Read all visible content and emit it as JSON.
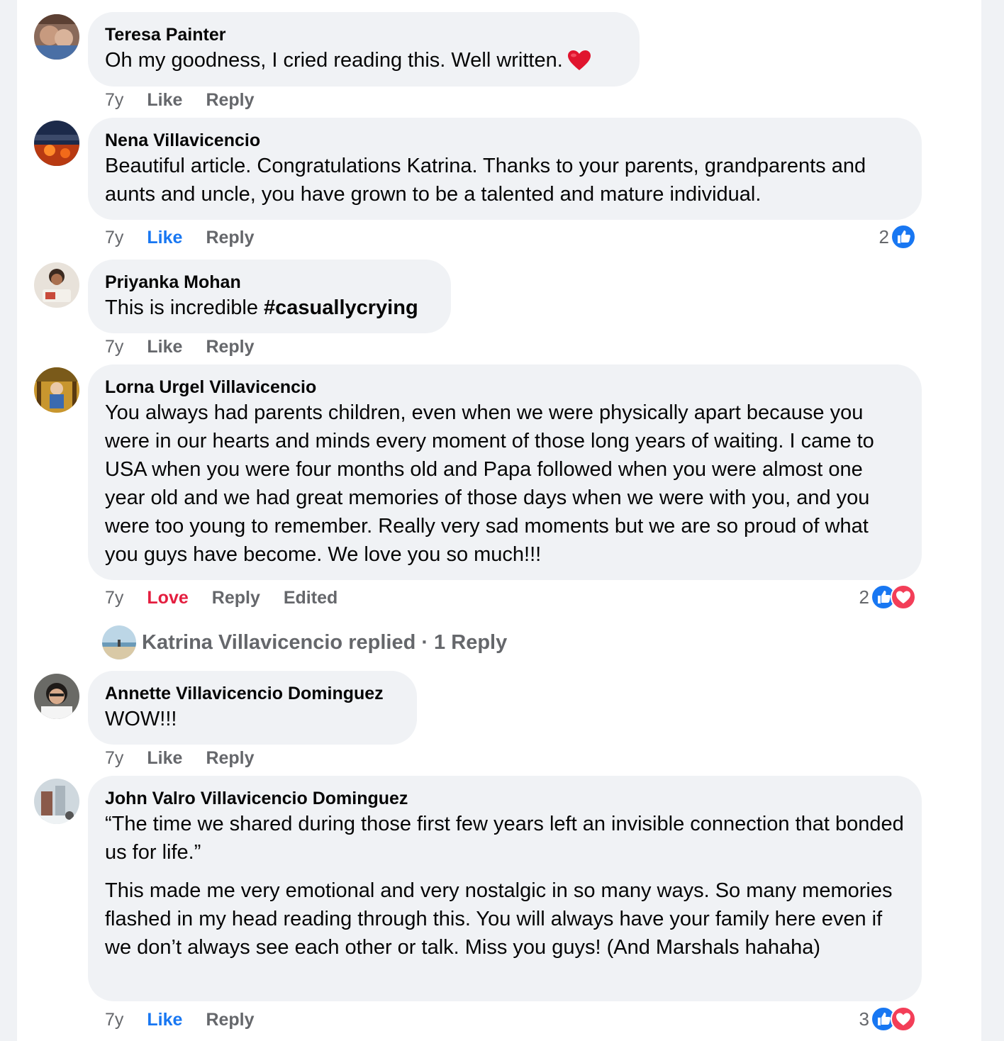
{
  "comments": [
    {
      "author": "Teresa Painter",
      "body": [
        "Oh my goodness, I cried reading this. Well written."
      ],
      "emoji": "red-heart",
      "time": "7y",
      "like_label": "Like",
      "reply_label": "Reply"
    },
    {
      "author": "Nena Villavicencio",
      "body": [
        "Beautiful article. Congratulations Katrina. Thanks to your parents, grandparents and aunts and uncle, you have grown to be a talented and mature individual."
      ],
      "time": "7y",
      "like_label": "Like",
      "like_state": "liked",
      "reply_label": "Reply",
      "reaction_count": "2",
      "reactions": [
        "like"
      ]
    },
    {
      "author": "Priyanka Mohan",
      "body_prefix": "This is incredible ",
      "hashtag": "#casuallycrying",
      "time": "7y",
      "like_label": "Like",
      "reply_label": "Reply"
    },
    {
      "author": "Lorna Urgel Villavicencio",
      "body": [
        "You always had parents children, even when we were physically apart because you were in our hearts and minds every moment of those long years of waiting. I came to USA when you were four months old and Papa followed when you were almost one year old and we had great memories of those days when we were with you, and you were too young to remember. Really very sad moments but we are so proud of what you guys have become. We love you so much!!!"
      ],
      "time": "7y",
      "like_label": "Love",
      "like_state": "loved",
      "reply_label": "Reply",
      "edited_label": "Edited",
      "reaction_count": "2",
      "reactions": [
        "like",
        "love"
      ],
      "replies_summary": "Katrina Villavicencio replied · 1 Reply"
    },
    {
      "author": "Annette Villavicencio Dominguez",
      "body": [
        "WOW!!!"
      ],
      "time": "7y",
      "like_label": "Like",
      "reply_label": "Reply"
    },
    {
      "author": "John Valro Villavicencio Dominguez",
      "body": [
        "“The time we shared during those first few years left an invisible connection that bonded us for life.”",
        "This made me very emotional and very nostalgic in so many ways. So many memories flashed in my head reading through this. You will always have your family here even if we don’t always see each other or talk. Miss you guys! (And Marshals hahaha)"
      ],
      "time": "7y",
      "like_label": "Like",
      "like_state": "liked",
      "reply_label": "Reply",
      "reaction_count": "3",
      "reactions": [
        "like",
        "love"
      ]
    }
  ],
  "colors": {
    "like_blue": "#1877f2",
    "love_red": "#e41e3f",
    "meta_gray": "#65676b",
    "bubble_bg": "#f0f2f5"
  }
}
